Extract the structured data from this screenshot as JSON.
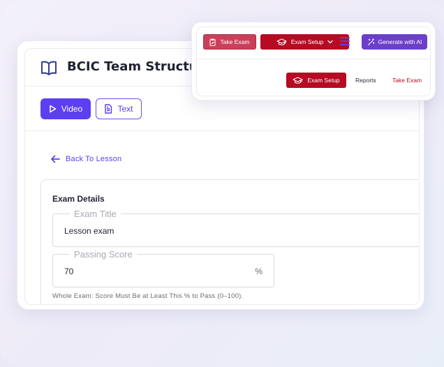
{
  "page": {
    "title": "BCIC Team Structure"
  },
  "tabs": {
    "video_label": "Video",
    "text_label": "Text"
  },
  "nav": {
    "back_label": "Back To Lesson"
  },
  "exam": {
    "heading": "Exam Details",
    "title_field": {
      "label": "Exam Title",
      "value": "Lesson exam"
    },
    "score_field": {
      "label": "Passing Score",
      "value": "70",
      "suffix": "%"
    },
    "helper": "Whole Exam: Score Must Be at Least This % to Pass (0–100)."
  },
  "toolbar": {
    "take_exam_label": "Take Exam",
    "exam_setup_label": "Exam Setup",
    "generate_ai_label": "Generate with AI",
    "sub_exam_setup_label": "Exam Setup",
    "reports_label": "Reports",
    "sub_take_exam_label": "Take Exam"
  },
  "colors": {
    "accent": "#5b3ff0",
    "exam_red": "#b50b23",
    "take_exam_pink": "#c8405a",
    "ai_purple": "#6b3fc8"
  },
  "icons": {
    "title": "book-open-icon",
    "video": "play-icon",
    "text": "document-icon",
    "back": "arrow-left-icon",
    "take_exam": "clipboard-check-icon",
    "exam_setup": "graduation-cap-icon",
    "dropdown": "chevron-down-icon",
    "menu": "hamburger-icon",
    "ai": "magic-wand-icon"
  }
}
